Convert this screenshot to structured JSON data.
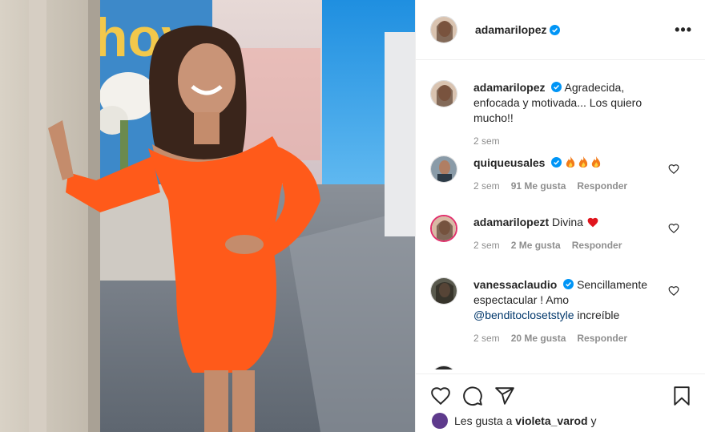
{
  "post": {
    "username": "adamarilopez",
    "more_icon": "more-horizontal-icon"
  },
  "caption": {
    "username": "adamarilopez",
    "text": "Agradecida, enfocada y motivada... Los quiero mucho!!",
    "time": "2 sem"
  },
  "comments": [
    {
      "username": "quiqueusales",
      "text": "",
      "emoji": "fire x3",
      "time": "2 sem",
      "likes": "91 Me gusta",
      "reply": "Responder"
    },
    {
      "username": "adamarilopezt",
      "text": "Divina",
      "emoji": "red heart",
      "time": "2 sem",
      "likes": "2 Me gusta",
      "reply": "Responder"
    },
    {
      "username": "vanessaclaudio",
      "text_before": "Sencillamente espectacular ! Amo",
      "mention": "@benditoclosetstyle",
      "text_after": "increíble",
      "time": "2 sem",
      "likes": "20 Me gusta",
      "reply": "Responder"
    }
  ],
  "likes_line": {
    "prefix": "Les gusta a",
    "user": "violeta_varod",
    "suffix": "y"
  },
  "colors": {
    "verified": "#0095f6",
    "dress": "#ff5a1a",
    "mention": "#00376b",
    "meta": "#8e8e8e"
  }
}
